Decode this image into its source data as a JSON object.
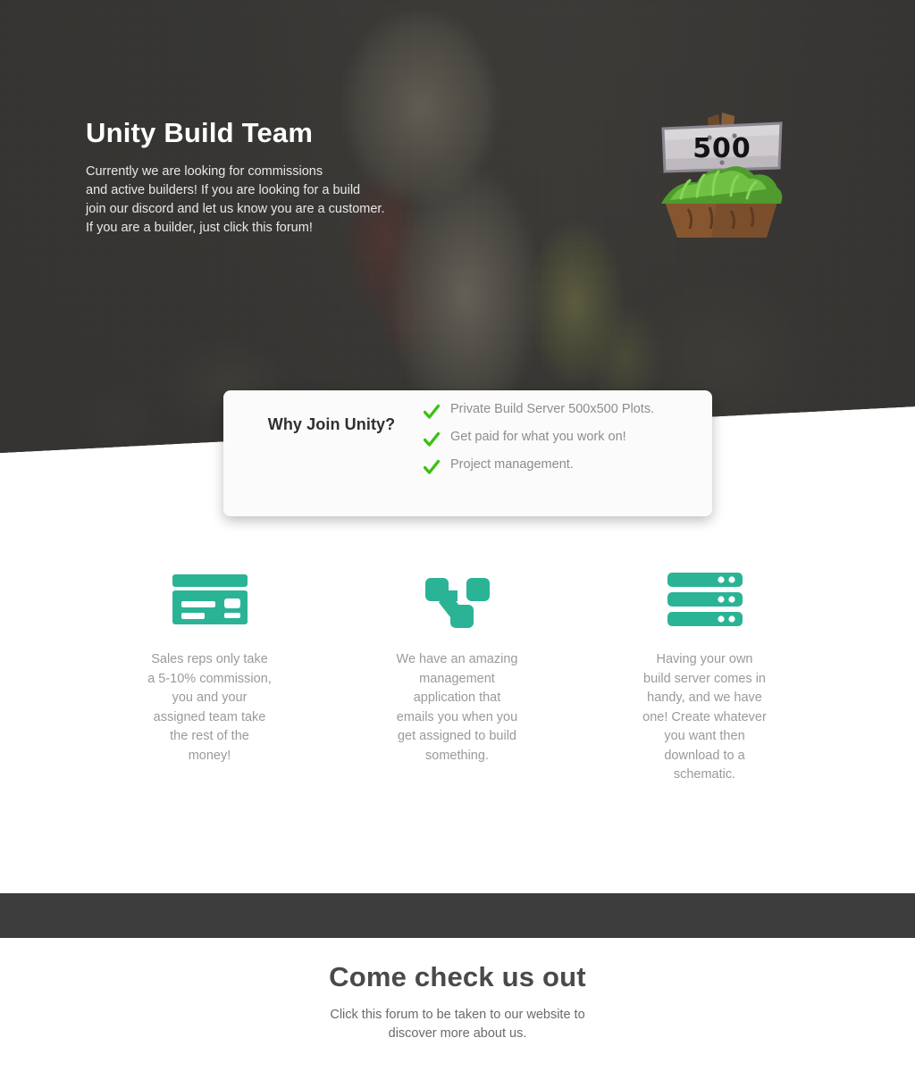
{
  "hero": {
    "title": "Unity Build Team",
    "subtitle_lines": [
      "Currently we are looking for commissions",
      "and active builders! If you are looking for a build",
      "join our discord and let us know you are a customer.",
      "If you are a builder, just click this forum!"
    ],
    "logo_sign_text": "500",
    "overlay_color": "#343331"
  },
  "why_card": {
    "title": "Why Join Unity?",
    "check_color": "#3dc113",
    "items": [
      "Private Build Server 500x500 Plots.",
      "Get paid for what you work on!",
      "Project management."
    ]
  },
  "features": {
    "accent_color": "#2bb396",
    "columns": [
      {
        "icon": "credit-card-icon",
        "text": "Sales reps only take a 5-10% commission, you and your assigned team take the rest of the money!"
      },
      {
        "icon": "sitemap-icon",
        "text": "We have an amazing management application that emails you when you get assigned to build something."
      },
      {
        "icon": "server-icon",
        "text": "Having your own build server comes in handy, and we have one! Create whatever you want then download to a schematic."
      }
    ]
  },
  "divider": {
    "color": "#3c3c3c"
  },
  "footer": {
    "title": "Come check us out",
    "subtitle_lines": [
      "Click this forum to be taken to our website to",
      "discover more about us."
    ]
  }
}
